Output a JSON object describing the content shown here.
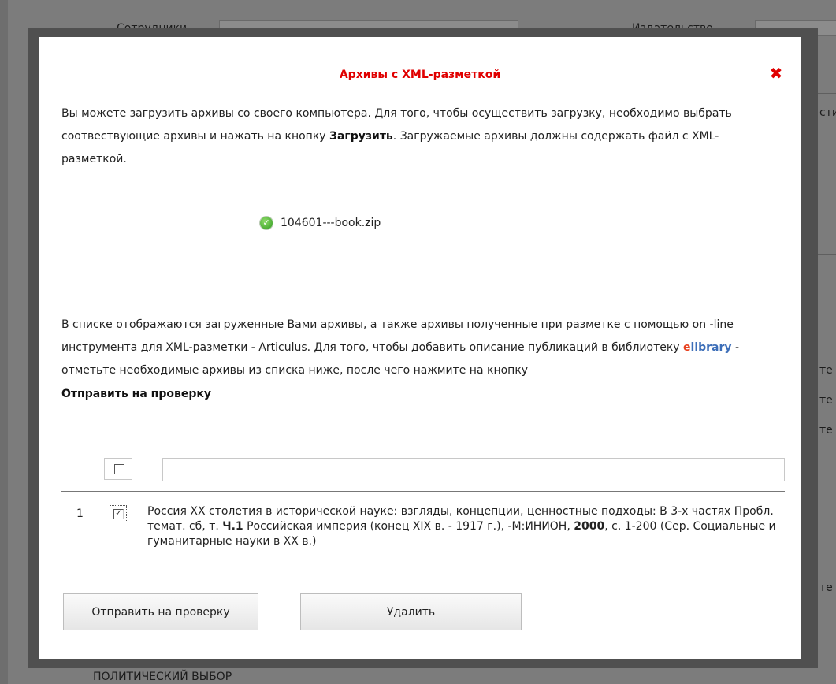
{
  "background": {
    "label_top_left": "Сотрудники",
    "label_top_right": "Издательство",
    "label_bottom": "ПОЛИТИЧЕСКИЙ ВЫБОР",
    "right_fragments": [
      "сти",
      "те",
      "те",
      "те",
      "те"
    ]
  },
  "modal": {
    "title": "Архивы с XML-разметкой",
    "close_icon": "close-x-icon",
    "intro_part1": "Вы можете загрузить архивы со своего компьютера. Для того, чтобы осуществить загрузку, необходимо выбрать соотвествующие архивы и нажать на кнопку ",
    "intro_bold": "Загрузить",
    "intro_part2": ". Загружаемые архивы должны содержать файл с XML-разметкой.",
    "uploaded_file": "104601---book.zip",
    "list_part1": "В списке отображаются загруженные Вами архивы, а также архивы полученные при разметке с помощью on -line инструмента для XML-разметки - Articulus. Для того, чтобы добавить описание публикаций в библиотеку ",
    "elibrary_e": "e",
    "elibrary_rest": "library",
    "list_part2": " - отметьте необходимые архивы из списка ниже, после чего нажмите на кнопку",
    "list_bold": "Отправить на проверку",
    "filter_value": "",
    "rows": [
      {
        "num": "1",
        "text_a": "Россия XX столетия в исторической науке: взгляды, концепции, ценностные подходы: В 3-х частях Пробл. темат. сб, т. ",
        "bold_a": "Ч.1",
        "text_b": " Российская империя (конец XIX в. - 1917 г.), -М:ИНИОН, ",
        "bold_b": "2000",
        "text_c": ", с. 1-200 (Сер. Социальные и гуманитарные науки в XX в.)"
      }
    ],
    "buttons": {
      "send": "Отправить на проверку",
      "delete": "Удалить"
    }
  },
  "colors": {
    "title": "#e00000",
    "elibrary_e": "#e8411f",
    "elibrary_rest": "#3c6eb8",
    "success_icon": "#2f9a1d"
  }
}
